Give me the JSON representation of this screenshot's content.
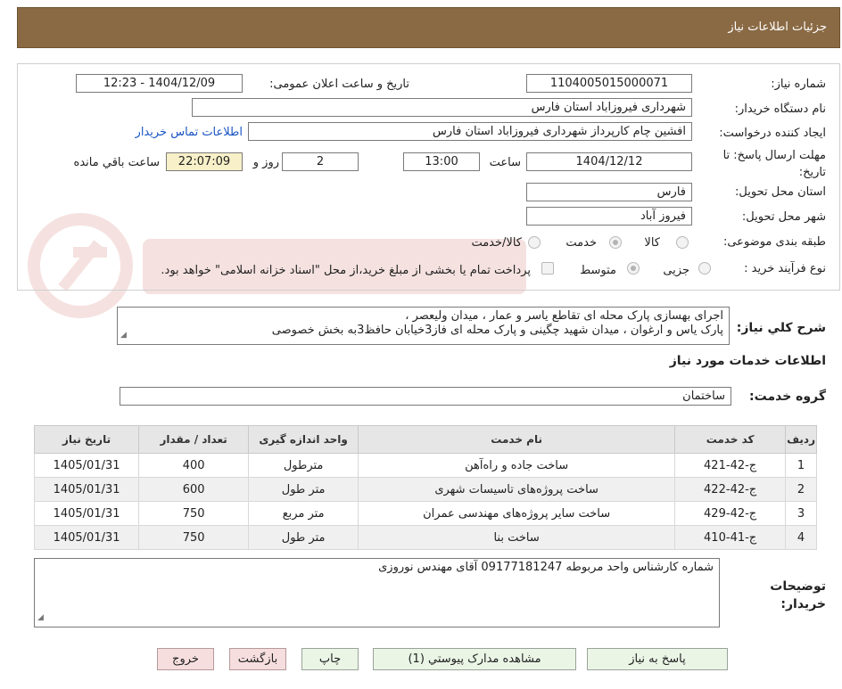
{
  "header": {
    "title": "جزئیات اطلاعات نیاز"
  },
  "fields": {
    "need_number_label": "شماره نیاز:",
    "need_number": "1104005015000071",
    "announce_label": "تاریخ و ساعت اعلان عمومی:",
    "announce_value": "1404/12/09 - 12:23",
    "buyer_org_label": "نام دستگاه خریدار:",
    "buyer_org": "شهرداری فیروزاباد استان فارس",
    "requester_label": "ایجاد کننده درخواست:",
    "requester": "افشین چام کارپرداز شهرداری فیروزاباد استان فارس",
    "contact_link": "اطلاعات تماس خریدار",
    "deadline_label": "مهلت ارسال پاسخ: تا تاریخ:",
    "deadline_date": "1404/12/12",
    "time_label": "ساعت",
    "deadline_time": "13:00",
    "days": "2",
    "days_label": "روز و",
    "remaining_time": "22:07:09",
    "remaining_label": "ساعت باقي مانده",
    "province_label": "استان محل تحویل:",
    "province": "فارس",
    "city_label": "شهر محل تحویل:",
    "city": "فیروز آباد",
    "category_label": "طبقه بندی موضوعی:",
    "category_options": [
      "کالا",
      "خدمت",
      "کالا/خدمت"
    ],
    "category_selected": "خدمت",
    "process_label": "نوع فرآیند خرید :",
    "process_options": [
      "جزیی",
      "متوسط"
    ],
    "process_selected": "جزیی",
    "payment_note": "پرداخت تمام یا بخشی از مبلغ خرید،از محل \"اسناد خزانه اسلامی\" خواهد بود."
  },
  "description": {
    "label": "شرح کلي نیاز:",
    "lines": [
      "اجرای بهسازی پارک محله ای تقاطع یاسر و عمار ، میدان ولیعصر ،",
      "پارک یاس و ارغوان ، میدان شهید چگینی و پارک محله ای فاز3خیابان حافظ3به بخش خصوصی"
    ]
  },
  "services": {
    "section_title": "اطلاعات خدمات مورد نیاز",
    "group_label": "گروه خدمت:",
    "group_value": "ساختمان",
    "columns": [
      "ردیف",
      "کد خدمت",
      "نام خدمت",
      "واحد اندازه گیری",
      "تعداد / مقدار",
      "تاریخ نیاز"
    ],
    "rows": [
      [
        "1",
        "ج-42-421",
        "ساخت جاده و راه‌آهن",
        "مترطول",
        "400",
        "1405/01/31"
      ],
      [
        "2",
        "ج-42-422",
        "ساخت پروژه‌های تاسیسات شهری",
        "متر طول",
        "600",
        "1405/01/31"
      ],
      [
        "3",
        "ج-42-429",
        "ساخت سایر پروژه‌های مهندسی عمران",
        "متر مربع",
        "750",
        "1405/01/31"
      ],
      [
        "4",
        "ج-41-410",
        "ساخت بنا",
        "متر طول",
        "750",
        "1405/01/31"
      ]
    ]
  },
  "buyer_notes": {
    "label": "توضیحات خریدار:",
    "text": "شماره کارشناس واحد مربوطه 09177181247 آقای مهندس نوروزی"
  },
  "buttons": {
    "reply": "پاسخ به نیاز",
    "attachments": "مشاهده مدارک پیوستي (1)",
    "print": "چاپ",
    "back": "بازگشت",
    "exit": "خروج"
  },
  "colors": {
    "header_bg": "#8a6a44",
    "link": "#1a55c4",
    "timer_bg": "#f7f0c8",
    "button_bg": "#eaf5e6",
    "button_pink": "#f7dede"
  }
}
